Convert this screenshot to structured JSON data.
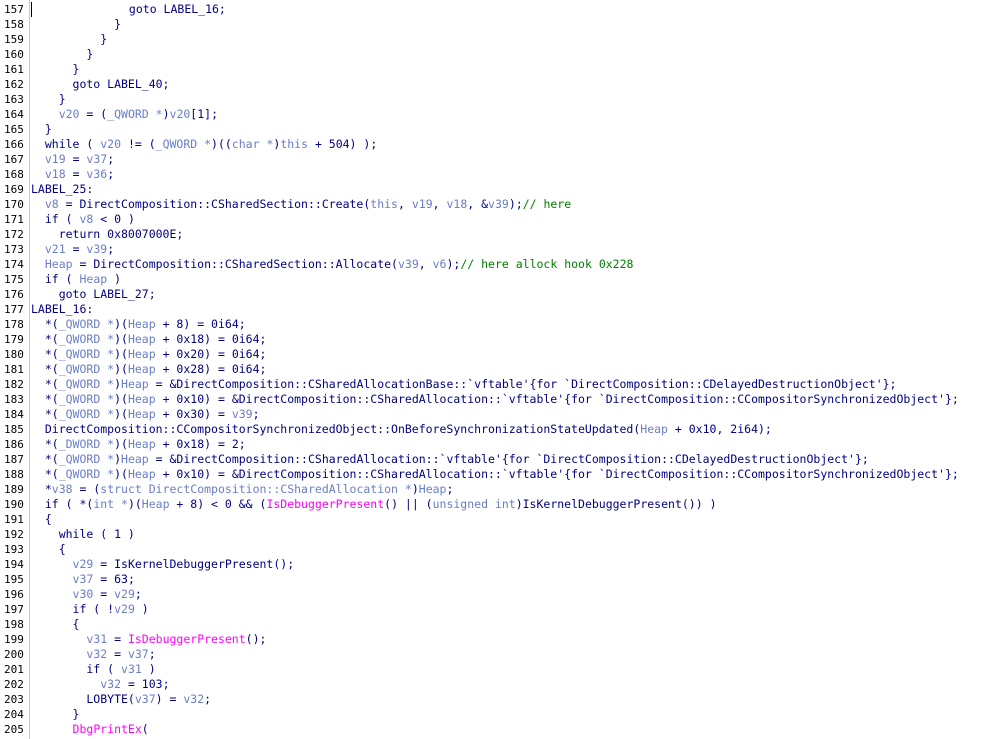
{
  "editor": {
    "colors": {
      "plain": "#000080",
      "variable": "#6a7ec5",
      "comment": "#008000",
      "import": "#ff00ff",
      "gutter_border": "#c8c8c8"
    },
    "lines": [
      {
        "n": "157",
        "tokens": [
          [
            "p",
            "              goto LABEL_16;"
          ]
        ]
      },
      {
        "n": "158",
        "tokens": [
          [
            "p",
            "            }"
          ]
        ]
      },
      {
        "n": "159",
        "tokens": [
          [
            "p",
            "          }"
          ]
        ]
      },
      {
        "n": "160",
        "tokens": [
          [
            "p",
            "        }"
          ]
        ]
      },
      {
        "n": "161",
        "tokens": [
          [
            "p",
            "      }"
          ]
        ]
      },
      {
        "n": "162",
        "tokens": [
          [
            "p",
            "      goto LABEL_40;"
          ]
        ]
      },
      {
        "n": "163",
        "tokens": [
          [
            "p",
            "    }"
          ]
        ]
      },
      {
        "n": "164",
        "tokens": [
          [
            "p",
            "    "
          ],
          [
            "v",
            "v20"
          ],
          [
            "p",
            " = ("
          ],
          [
            "v",
            "_QWORD *"
          ],
          [
            "p",
            ")"
          ],
          [
            "v",
            "v20"
          ],
          [
            "p",
            "[1];"
          ]
        ]
      },
      {
        "n": "165",
        "tokens": [
          [
            "p",
            "  }"
          ]
        ]
      },
      {
        "n": "166",
        "tokens": [
          [
            "p",
            "  while ( "
          ],
          [
            "v",
            "v20"
          ],
          [
            "p",
            " != ("
          ],
          [
            "v",
            "_QWORD *"
          ],
          [
            "p",
            ")(("
          ],
          [
            "v",
            "char *"
          ],
          [
            "p",
            ")"
          ],
          [
            "v",
            "this"
          ],
          [
            "p",
            " + 504) );"
          ]
        ]
      },
      {
        "n": "167",
        "tokens": [
          [
            "p",
            "  "
          ],
          [
            "v",
            "v19"
          ],
          [
            "p",
            " = "
          ],
          [
            "v",
            "v37"
          ],
          [
            "p",
            ";"
          ]
        ]
      },
      {
        "n": "168",
        "tokens": [
          [
            "p",
            "  "
          ],
          [
            "v",
            "v18"
          ],
          [
            "p",
            " = "
          ],
          [
            "v",
            "v36"
          ],
          [
            "p",
            ";"
          ]
        ]
      },
      {
        "n": "169",
        "tokens": [
          [
            "p",
            "LABEL_25:"
          ]
        ]
      },
      {
        "n": "170",
        "tokens": [
          [
            "p",
            "  "
          ],
          [
            "v",
            "v8"
          ],
          [
            "p",
            " = DirectComposition::CSharedSection::Create("
          ],
          [
            "v",
            "this"
          ],
          [
            "p",
            ", "
          ],
          [
            "v",
            "v19"
          ],
          [
            "p",
            ", "
          ],
          [
            "v",
            "v18"
          ],
          [
            "p",
            ", &"
          ],
          [
            "v",
            "v39"
          ],
          [
            "p",
            ");"
          ],
          [
            "c",
            "// here"
          ]
        ]
      },
      {
        "n": "171",
        "tokens": [
          [
            "p",
            "  if ( "
          ],
          [
            "v",
            "v8"
          ],
          [
            "p",
            " < 0 )"
          ]
        ]
      },
      {
        "n": "172",
        "tokens": [
          [
            "p",
            "    return 0x8007000E;"
          ]
        ]
      },
      {
        "n": "173",
        "tokens": [
          [
            "p",
            "  "
          ],
          [
            "v",
            "v21"
          ],
          [
            "p",
            " = "
          ],
          [
            "v",
            "v39"
          ],
          [
            "p",
            ";"
          ]
        ]
      },
      {
        "n": "174",
        "tokens": [
          [
            "p",
            "  "
          ],
          [
            "v",
            "Heap"
          ],
          [
            "p",
            " = DirectComposition::CSharedSection::Allocate("
          ],
          [
            "v",
            "v39"
          ],
          [
            "p",
            ", "
          ],
          [
            "v",
            "v6"
          ],
          [
            "p",
            ");"
          ],
          [
            "c",
            "// here allock hook 0x228"
          ]
        ]
      },
      {
        "n": "175",
        "tokens": [
          [
            "p",
            "  if ( "
          ],
          [
            "v",
            "Heap"
          ],
          [
            "p",
            " )"
          ]
        ]
      },
      {
        "n": "176",
        "tokens": [
          [
            "p",
            "    goto LABEL_27;"
          ]
        ]
      },
      {
        "n": "177",
        "tokens": [
          [
            "p",
            "LABEL_16:"
          ]
        ]
      },
      {
        "n": "178",
        "tokens": [
          [
            "p",
            "  *("
          ],
          [
            "v",
            "_QWORD *"
          ],
          [
            "p",
            ")("
          ],
          [
            "v",
            "Heap"
          ],
          [
            "p",
            " + 8) = 0i64;"
          ]
        ]
      },
      {
        "n": "179",
        "tokens": [
          [
            "p",
            "  *("
          ],
          [
            "v",
            "_QWORD *"
          ],
          [
            "p",
            ")("
          ],
          [
            "v",
            "Heap"
          ],
          [
            "p",
            " + 0x18) = 0i64;"
          ]
        ]
      },
      {
        "n": "180",
        "tokens": [
          [
            "p",
            "  *("
          ],
          [
            "v",
            "_QWORD *"
          ],
          [
            "p",
            ")("
          ],
          [
            "v",
            "Heap"
          ],
          [
            "p",
            " + 0x20) = 0i64;"
          ]
        ]
      },
      {
        "n": "181",
        "tokens": [
          [
            "p",
            "  *("
          ],
          [
            "v",
            "_QWORD *"
          ],
          [
            "p",
            ")("
          ],
          [
            "v",
            "Heap"
          ],
          [
            "p",
            " + 0x28) = 0i64;"
          ]
        ]
      },
      {
        "n": "182",
        "tokens": [
          [
            "p",
            "  *("
          ],
          [
            "v",
            "_QWORD *"
          ],
          [
            "p",
            ")"
          ],
          [
            "v",
            "Heap"
          ],
          [
            "p",
            " = &DirectComposition::CSharedAllocationBase::`vftable'{for `DirectComposition::CDelayedDestructionObject'};"
          ]
        ]
      },
      {
        "n": "183",
        "tokens": [
          [
            "p",
            "  *("
          ],
          [
            "v",
            "_QWORD *"
          ],
          [
            "p",
            ")("
          ],
          [
            "v",
            "Heap"
          ],
          [
            "p",
            " + 0x10) = &DirectComposition::CSharedAllocation::`vftable'{for `DirectComposition::CCompositorSynchronizedObject'};"
          ]
        ]
      },
      {
        "n": "184",
        "tokens": [
          [
            "p",
            "  *("
          ],
          [
            "v",
            "_QWORD *"
          ],
          [
            "p",
            ")("
          ],
          [
            "v",
            "Heap"
          ],
          [
            "p",
            " + 0x30) = "
          ],
          [
            "v",
            "v39"
          ],
          [
            "p",
            ";"
          ]
        ]
      },
      {
        "n": "185",
        "tokens": [
          [
            "p",
            "  DirectComposition::CCompositorSynchronizedObject::OnBeforeSynchronizationStateUpdated("
          ],
          [
            "v",
            "Heap"
          ],
          [
            "p",
            " + 0x10, 2i64);"
          ]
        ]
      },
      {
        "n": "186",
        "tokens": [
          [
            "p",
            "  *("
          ],
          [
            "v",
            "_DWORD *"
          ],
          [
            "p",
            ")("
          ],
          [
            "v",
            "Heap"
          ],
          [
            "p",
            " + 0x18) = 2;"
          ]
        ]
      },
      {
        "n": "187",
        "tokens": [
          [
            "p",
            "  *("
          ],
          [
            "v",
            "_QWORD *"
          ],
          [
            "p",
            ")"
          ],
          [
            "v",
            "Heap"
          ],
          [
            "p",
            " = &DirectComposition::CSharedAllocation::`vftable'{for `DirectComposition::CDelayedDestructionObject'};"
          ]
        ]
      },
      {
        "n": "188",
        "tokens": [
          [
            "p",
            "  *("
          ],
          [
            "v",
            "_QWORD *"
          ],
          [
            "p",
            ")("
          ],
          [
            "v",
            "Heap"
          ],
          [
            "p",
            " + 0x10) = &DirectComposition::CSharedAllocation::`vftable'{for `DirectComposition::CCompositorSynchronizedObject'};"
          ]
        ]
      },
      {
        "n": "189",
        "tokens": [
          [
            "p",
            "  *"
          ],
          [
            "v",
            "v38"
          ],
          [
            "p",
            " = ("
          ],
          [
            "v",
            "struct DirectComposition::CSharedAllocation *"
          ],
          [
            "p",
            ")"
          ],
          [
            "v",
            "Heap"
          ],
          [
            "p",
            ";"
          ]
        ]
      },
      {
        "n": "190",
        "tokens": [
          [
            "p",
            "  if ( *("
          ],
          [
            "v",
            "int *"
          ],
          [
            "p",
            ")("
          ],
          [
            "v",
            "Heap"
          ],
          [
            "p",
            " + 8) < 0 && ("
          ],
          [
            "i",
            "IsDebuggerPresent"
          ],
          [
            "p",
            "() || ("
          ],
          [
            "v",
            "unsigned int"
          ],
          [
            "p",
            ")IsKernelDebuggerPresent()) )"
          ]
        ]
      },
      {
        "n": "191",
        "tokens": [
          [
            "p",
            "  {"
          ]
        ]
      },
      {
        "n": "192",
        "tokens": [
          [
            "p",
            "    while ( 1 )"
          ]
        ]
      },
      {
        "n": "193",
        "tokens": [
          [
            "p",
            "    {"
          ]
        ]
      },
      {
        "n": "194",
        "tokens": [
          [
            "p",
            "      "
          ],
          [
            "v",
            "v29"
          ],
          [
            "p",
            " = IsKernelDebuggerPresent();"
          ]
        ]
      },
      {
        "n": "195",
        "tokens": [
          [
            "p",
            "      "
          ],
          [
            "v",
            "v37"
          ],
          [
            "p",
            " = 63;"
          ]
        ]
      },
      {
        "n": "196",
        "tokens": [
          [
            "p",
            "      "
          ],
          [
            "v",
            "v30"
          ],
          [
            "p",
            " = "
          ],
          [
            "v",
            "v29"
          ],
          [
            "p",
            ";"
          ]
        ]
      },
      {
        "n": "197",
        "tokens": [
          [
            "p",
            "      if ( !"
          ],
          [
            "v",
            "v29"
          ],
          [
            "p",
            " )"
          ]
        ]
      },
      {
        "n": "198",
        "tokens": [
          [
            "p",
            "      {"
          ]
        ]
      },
      {
        "n": "199",
        "tokens": [
          [
            "p",
            "        "
          ],
          [
            "v",
            "v31"
          ],
          [
            "p",
            " = "
          ],
          [
            "i",
            "IsDebuggerPresent"
          ],
          [
            "p",
            "();"
          ]
        ]
      },
      {
        "n": "200",
        "tokens": [
          [
            "p",
            "        "
          ],
          [
            "v",
            "v32"
          ],
          [
            "p",
            " = "
          ],
          [
            "v",
            "v37"
          ],
          [
            "p",
            ";"
          ]
        ]
      },
      {
        "n": "201",
        "tokens": [
          [
            "p",
            "        if ( "
          ],
          [
            "v",
            "v31"
          ],
          [
            "p",
            " )"
          ]
        ]
      },
      {
        "n": "202",
        "tokens": [
          [
            "p",
            "          "
          ],
          [
            "v",
            "v32"
          ],
          [
            "p",
            " = 103;"
          ]
        ]
      },
      {
        "n": "203",
        "tokens": [
          [
            "p",
            "        LOBYTE("
          ],
          [
            "v",
            "v37"
          ],
          [
            "p",
            ") = "
          ],
          [
            "v",
            "v32"
          ],
          [
            "p",
            ";"
          ]
        ]
      },
      {
        "n": "204",
        "tokens": [
          [
            "p",
            "      }"
          ]
        ]
      },
      {
        "n": "205",
        "tokens": [
          [
            "p",
            "      "
          ],
          [
            "i",
            "DbgPrintEx"
          ],
          [
            "p",
            "("
          ]
        ]
      }
    ]
  }
}
